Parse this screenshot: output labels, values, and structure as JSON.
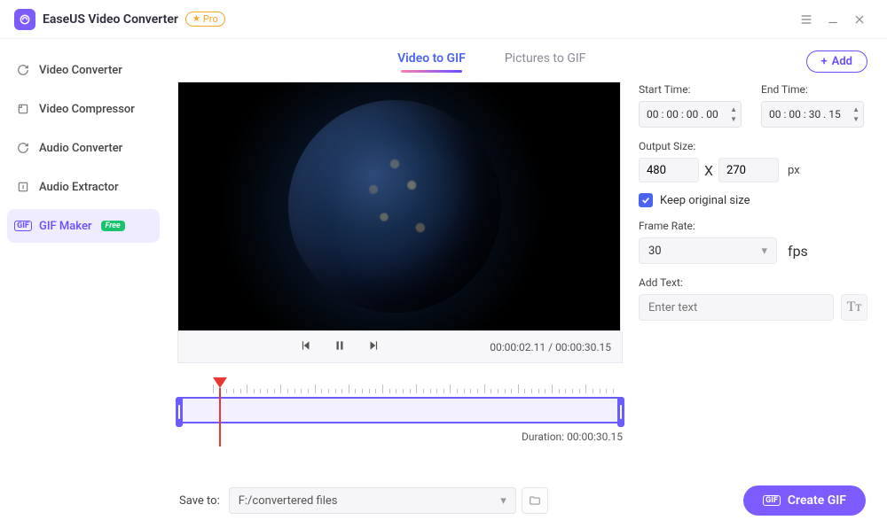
{
  "app": {
    "title": "EaseUS Video Converter",
    "pro": "Pro"
  },
  "sidebar": {
    "items": [
      {
        "label": "Video Converter"
      },
      {
        "label": "Video Compressor"
      },
      {
        "label": "Audio Converter"
      },
      {
        "label": "Audio Extractor"
      },
      {
        "label": "GIF Maker",
        "badge": "Free"
      }
    ]
  },
  "tabs": {
    "video": "Video to GIF",
    "pictures": "Pictures to GIF",
    "add": "Add"
  },
  "player": {
    "current": "00:00:02.11",
    "total": "00:00:30.15",
    "sep": " / "
  },
  "params": {
    "start_label": "Start Time:",
    "start": "00 : 00 : 00 . 00",
    "end_label": "End Time:",
    "end": "00 : 00 : 30 . 15",
    "output_size_label": "Output Size:",
    "w": "480",
    "x": "X",
    "h": "270",
    "px": "px",
    "keep": "Keep original size",
    "fr_label": "Frame Rate:",
    "fr": "30",
    "fps": "fps",
    "addtext_label": "Add Text:",
    "addtext_ph": "Enter text",
    "tt": "Tᴛ"
  },
  "timeline": {
    "dur_label": "Duration: ",
    "dur": "00:00:30.15"
  },
  "footer": {
    "save_label": "Save to:",
    "path": "F:/convertered files",
    "create": "Create GIF",
    "gif": "GIF"
  }
}
